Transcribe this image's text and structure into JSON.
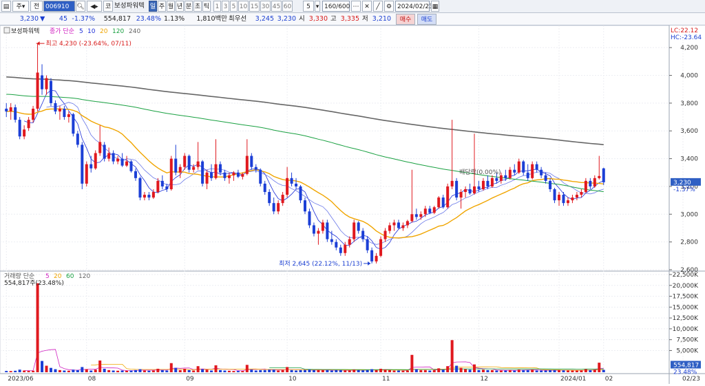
{
  "toolbar": {
    "period_select": "주",
    "code_type": "전",
    "stock_code": "006910",
    "stock_prefix": "코",
    "stock_name": "보성파워텍",
    "tabs": [
      "일",
      "주",
      "월",
      "년",
      "분",
      "초",
      "틱"
    ],
    "active_tab": "일",
    "minute_options": [
      "1",
      "3",
      "5",
      "10",
      "15",
      "30",
      "45",
      "60"
    ],
    "interval_value": "5",
    "count_display": "160/600",
    "date_value": "2024/02/23"
  },
  "quote": {
    "price": "3,230",
    "direction_arrow": "▼",
    "change": "45",
    "change_rate": "-1.37%",
    "volume": "554,817",
    "volume_rate": "23.48%",
    "turnover_rate": "1.13%",
    "amount": "1,810백만",
    "prefer_label": "최우선",
    "ask": "3,245",
    "bid": "3,230",
    "open_label": "시",
    "open": "3,330",
    "high_label": "고",
    "high": "3,335",
    "low_label": "저",
    "low": "3,210",
    "buy_button": "매수",
    "sell_button": "매도"
  },
  "price_panel": {
    "name_label": "보성파워텍",
    "legend_prefix": "종가 단순",
    "ma_periods": [
      {
        "label": "5",
        "color": "#1e2fd8"
      },
      {
        "label": "10",
        "color": "#1e2fd8"
      },
      {
        "label": "20",
        "color": "#f0a500"
      },
      {
        "label": "120",
        "color": "#18a040"
      },
      {
        "label": "240",
        "color": "#666666"
      }
    ],
    "lc_label": "LC:22.12",
    "hc_label": "HC:-23.64",
    "y_ticks": [
      "4,200",
      "4,000",
      "3,800",
      "3,600",
      "3,400",
      "3,200",
      "3,000",
      "2,800",
      "2,600"
    ],
    "current_price_label": "3,230",
    "current_rate_label": "-1.37%",
    "high_annotation": "최고 4,230 (-23.64%, 07/11)",
    "low_annotation": "최저 2,645 (22.12%, 11/13)",
    "dividend_annotation": "배당락(0.00%)"
  },
  "volume_panel": {
    "legend_prefix": "거래량 단순",
    "ma_periods": [
      {
        "label": "5",
        "color": "#d020c0"
      },
      {
        "label": "20",
        "color": "#f0a500"
      },
      {
        "label": "60",
        "color": "#18a040"
      },
      {
        "label": "120",
        "color": "#666666"
      }
    ],
    "current_value_label": "554,817주(23.48%)",
    "y_ticks": [
      "22,500K",
      "20,000K",
      "17,500K",
      "15,000K",
      "12,500K",
      "10,000K",
      "7,500K",
      "5,000K"
    ],
    "current_volume_label": "554,817",
    "current_volume_rate": "23.48%"
  },
  "x_axis": {
    "labels": [
      "2023/06",
      "08",
      "09",
      "10",
      "11",
      "12",
      "2024/01",
      "02",
      "02/23"
    ]
  },
  "chart_data": {
    "type": "candlestick",
    "price_axis": {
      "min": 2600,
      "max": 4300
    },
    "volume_axis": {
      "min": 0,
      "max": 22500,
      "unit": "K"
    },
    "candles": [
      {
        "o": 3760,
        "h": 3800,
        "l": 3700,
        "c": 3740,
        "v": 300
      },
      {
        "o": 3740,
        "h": 3800,
        "l": 3680,
        "c": 3770,
        "v": 280
      },
      {
        "o": 3770,
        "h": 3790,
        "l": 3660,
        "c": 3680,
        "v": 350
      },
      {
        "o": 3680,
        "h": 3700,
        "l": 3540,
        "c": 3560,
        "v": 600
      },
      {
        "o": 3560,
        "h": 3640,
        "l": 3540,
        "c": 3610,
        "v": 400
      },
      {
        "o": 3620,
        "h": 3700,
        "l": 3600,
        "c": 3680,
        "v": 300
      },
      {
        "o": 3680,
        "h": 3780,
        "l": 3660,
        "c": 3760,
        "v": 350
      },
      {
        "o": 3760,
        "h": 4230,
        "l": 3740,
        "c": 4020,
        "v": 20500
      },
      {
        "o": 4000,
        "h": 4080,
        "l": 3860,
        "c": 3900,
        "v": 2600
      },
      {
        "o": 3900,
        "h": 4000,
        "l": 3860,
        "c": 3980,
        "v": 1500
      },
      {
        "o": 3960,
        "h": 3980,
        "l": 3780,
        "c": 3800,
        "v": 1000
      },
      {
        "o": 3800,
        "h": 3820,
        "l": 3720,
        "c": 3740,
        "v": 700
      },
      {
        "o": 3740,
        "h": 3780,
        "l": 3680,
        "c": 3760,
        "v": 500
      },
      {
        "o": 3760,
        "h": 3780,
        "l": 3680,
        "c": 3700,
        "v": 400
      },
      {
        "o": 3700,
        "h": 3740,
        "l": 3660,
        "c": 3720,
        "v": 350
      },
      {
        "o": 3720,
        "h": 3730,
        "l": 3560,
        "c": 3580,
        "v": 600
      },
      {
        "o": 3580,
        "h": 3600,
        "l": 3480,
        "c": 3500,
        "v": 500
      },
      {
        "o": 3500,
        "h": 3520,
        "l": 3180,
        "c": 3220,
        "v": 1200
      },
      {
        "o": 3220,
        "h": 3380,
        "l": 3200,
        "c": 3360,
        "v": 700
      },
      {
        "o": 3360,
        "h": 3420,
        "l": 3300,
        "c": 3330,
        "v": 400
      },
      {
        "o": 3330,
        "h": 3460,
        "l": 3320,
        "c": 3440,
        "v": 600
      },
      {
        "o": 3440,
        "h": 3640,
        "l": 3420,
        "c": 3520,
        "v": 2700
      },
      {
        "o": 3500,
        "h": 3520,
        "l": 3380,
        "c": 3400,
        "v": 800
      },
      {
        "o": 3400,
        "h": 3480,
        "l": 3380,
        "c": 3440,
        "v": 500
      },
      {
        "o": 3440,
        "h": 3460,
        "l": 3360,
        "c": 3380,
        "v": 400
      },
      {
        "o": 3380,
        "h": 3420,
        "l": 3360,
        "c": 3400,
        "v": 350
      },
      {
        "o": 3400,
        "h": 3440,
        "l": 3340,
        "c": 3350,
        "v": 400
      },
      {
        "o": 3350,
        "h": 3420,
        "l": 3340,
        "c": 3380,
        "v": 350
      },
      {
        "o": 3380,
        "h": 3390,
        "l": 3300,
        "c": 3310,
        "v": 400
      },
      {
        "o": 3310,
        "h": 3330,
        "l": 3240,
        "c": 3260,
        "v": 500
      },
      {
        "o": 3260,
        "h": 3270,
        "l": 3100,
        "c": 3120,
        "v": 700
      },
      {
        "o": 3120,
        "h": 3160,
        "l": 3100,
        "c": 3140,
        "v": 400
      },
      {
        "o": 3140,
        "h": 3160,
        "l": 3100,
        "c": 3120,
        "v": 350
      },
      {
        "o": 3120,
        "h": 3180,
        "l": 3110,
        "c": 3160,
        "v": 400
      },
      {
        "o": 3160,
        "h": 3260,
        "l": 3150,
        "c": 3240,
        "v": 800
      },
      {
        "o": 3240,
        "h": 3280,
        "l": 3180,
        "c": 3200,
        "v": 500
      },
      {
        "o": 3200,
        "h": 3220,
        "l": 3160,
        "c": 3180,
        "v": 400
      },
      {
        "o": 3180,
        "h": 3420,
        "l": 3170,
        "c": 3400,
        "v": 2100
      },
      {
        "o": 3400,
        "h": 3500,
        "l": 3280,
        "c": 3300,
        "v": 1000
      },
      {
        "o": 3300,
        "h": 3360,
        "l": 3260,
        "c": 3340,
        "v": 500
      },
      {
        "o": 3340,
        "h": 3440,
        "l": 3320,
        "c": 3420,
        "v": 800
      },
      {
        "o": 3420,
        "h": 3430,
        "l": 3300,
        "c": 3320,
        "v": 500
      },
      {
        "o": 3320,
        "h": 3360,
        "l": 3300,
        "c": 3340,
        "v": 400
      },
      {
        "o": 3340,
        "h": 3520,
        "l": 3320,
        "c": 3380,
        "v": 1400
      },
      {
        "o": 3380,
        "h": 3390,
        "l": 3200,
        "c": 3220,
        "v": 700
      },
      {
        "o": 3220,
        "h": 3320,
        "l": 3180,
        "c": 3300,
        "v": 600
      },
      {
        "o": 3300,
        "h": 3360,
        "l": 3240,
        "c": 3260,
        "v": 400
      },
      {
        "o": 3260,
        "h": 3540,
        "l": 3250,
        "c": 3360,
        "v": 1600
      },
      {
        "o": 3360,
        "h": 3380,
        "l": 3280,
        "c": 3300,
        "v": 500
      },
      {
        "o": 3300,
        "h": 3320,
        "l": 3240,
        "c": 3260,
        "v": 400
      },
      {
        "o": 3260,
        "h": 3300,
        "l": 3220,
        "c": 3280,
        "v": 350
      },
      {
        "o": 3280,
        "h": 3310,
        "l": 3240,
        "c": 3300,
        "v": 300
      },
      {
        "o": 3300,
        "h": 3320,
        "l": 3260,
        "c": 3270,
        "v": 300
      },
      {
        "o": 3270,
        "h": 3300,
        "l": 3250,
        "c": 3290,
        "v": 300
      },
      {
        "o": 3290,
        "h": 3540,
        "l": 3280,
        "c": 3420,
        "v": 1700
      },
      {
        "o": 3420,
        "h": 3440,
        "l": 3320,
        "c": 3340,
        "v": 600
      },
      {
        "o": 3340,
        "h": 3360,
        "l": 3300,
        "c": 3320,
        "v": 400
      },
      {
        "o": 3320,
        "h": 3330,
        "l": 3200,
        "c": 3220,
        "v": 500
      },
      {
        "o": 3220,
        "h": 3240,
        "l": 3140,
        "c": 3160,
        "v": 500
      },
      {
        "o": 3160,
        "h": 3180,
        "l": 3060,
        "c": 3080,
        "v": 600
      },
      {
        "o": 3080,
        "h": 3120,
        "l": 3000,
        "c": 3020,
        "v": 600
      },
      {
        "o": 3020,
        "h": 3100,
        "l": 3000,
        "c": 3080,
        "v": 400
      },
      {
        "o": 3080,
        "h": 3160,
        "l": 3060,
        "c": 3140,
        "v": 500
      },
      {
        "o": 3140,
        "h": 3340,
        "l": 3120,
        "c": 3260,
        "v": 1200
      },
      {
        "o": 3260,
        "h": 3300,
        "l": 3200,
        "c": 3220,
        "v": 500
      },
      {
        "o": 3220,
        "h": 3260,
        "l": 3180,
        "c": 3200,
        "v": 400
      },
      {
        "o": 3200,
        "h": 3210,
        "l": 3080,
        "c": 3100,
        "v": 500
      },
      {
        "o": 3100,
        "h": 3120,
        "l": 3000,
        "c": 3020,
        "v": 500
      },
      {
        "o": 3020,
        "h": 3040,
        "l": 2900,
        "c": 2920,
        "v": 600
      },
      {
        "o": 2920,
        "h": 2940,
        "l": 2840,
        "c": 2860,
        "v": 500
      },
      {
        "o": 2860,
        "h": 2900,
        "l": 2780,
        "c": 2880,
        "v": 500
      },
      {
        "o": 2880,
        "h": 2960,
        "l": 2860,
        "c": 2940,
        "v": 500
      },
      {
        "o": 2940,
        "h": 2960,
        "l": 2800,
        "c": 2820,
        "v": 500
      },
      {
        "o": 2820,
        "h": 2880,
        "l": 2780,
        "c": 2800,
        "v": 400
      },
      {
        "o": 2800,
        "h": 2820,
        "l": 2740,
        "c": 2760,
        "v": 500
      },
      {
        "o": 2760,
        "h": 2780,
        "l": 2700,
        "c": 2720,
        "v": 500
      },
      {
        "o": 2720,
        "h": 2800,
        "l": 2700,
        "c": 2780,
        "v": 400
      },
      {
        "o": 2780,
        "h": 2840,
        "l": 2760,
        "c": 2820,
        "v": 400
      },
      {
        "o": 2820,
        "h": 2960,
        "l": 2800,
        "c": 2940,
        "v": 600
      },
      {
        "o": 2940,
        "h": 2950,
        "l": 2860,
        "c": 2880,
        "v": 500
      },
      {
        "o": 2880,
        "h": 2900,
        "l": 2800,
        "c": 2820,
        "v": 450
      },
      {
        "o": 2820,
        "h": 2840,
        "l": 2720,
        "c": 2740,
        "v": 500
      },
      {
        "o": 2740,
        "h": 2760,
        "l": 2645,
        "c": 2660,
        "v": 700
      },
      {
        "o": 2660,
        "h": 2720,
        "l": 2645,
        "c": 2700,
        "v": 500
      },
      {
        "o": 2700,
        "h": 2840,
        "l": 2690,
        "c": 2820,
        "v": 800
      },
      {
        "o": 2820,
        "h": 2900,
        "l": 2800,
        "c": 2880,
        "v": 600
      },
      {
        "o": 2880,
        "h": 2940,
        "l": 2860,
        "c": 2920,
        "v": 500
      },
      {
        "o": 2920,
        "h": 2960,
        "l": 2880,
        "c": 2940,
        "v": 400
      },
      {
        "o": 2940,
        "h": 2960,
        "l": 2890,
        "c": 2900,
        "v": 400
      },
      {
        "o": 2900,
        "h": 2940,
        "l": 2880,
        "c": 2920,
        "v": 350
      },
      {
        "o": 2920,
        "h": 2960,
        "l": 2900,
        "c": 2950,
        "v": 400
      },
      {
        "o": 2950,
        "h": 3320,
        "l": 2940,
        "c": 3000,
        "v": 4000
      },
      {
        "o": 3000,
        "h": 3040,
        "l": 2960,
        "c": 2980,
        "v": 700
      },
      {
        "o": 2980,
        "h": 3020,
        "l": 2960,
        "c": 3000,
        "v": 500
      },
      {
        "o": 3000,
        "h": 3060,
        "l": 2980,
        "c": 3040,
        "v": 500
      },
      {
        "o": 3040,
        "h": 3060,
        "l": 3000,
        "c": 3010,
        "v": 400
      },
      {
        "o": 3010,
        "h": 3060,
        "l": 3000,
        "c": 3050,
        "v": 500
      },
      {
        "o": 3050,
        "h": 3130,
        "l": 3040,
        "c": 3120,
        "v": 900
      },
      {
        "o": 3120,
        "h": 3140,
        "l": 3040,
        "c": 3050,
        "v": 600
      },
      {
        "o": 3050,
        "h": 3220,
        "l": 3040,
        "c": 3200,
        "v": 1400
      },
      {
        "o": 3200,
        "h": 3680,
        "l": 3180,
        "c": 3240,
        "v": 7400
      },
      {
        "o": 3240,
        "h": 3260,
        "l": 3100,
        "c": 3120,
        "v": 1500
      },
      {
        "o": 3120,
        "h": 3180,
        "l": 3040,
        "c": 3160,
        "v": 1000
      },
      {
        "o": 3160,
        "h": 3200,
        "l": 3120,
        "c": 3180,
        "v": 700
      },
      {
        "o": 3180,
        "h": 3220,
        "l": 3140,
        "c": 3150,
        "v": 600
      },
      {
        "o": 3150,
        "h": 3580,
        "l": 3140,
        "c": 3200,
        "v": 1800
      },
      {
        "o": 3200,
        "h": 3240,
        "l": 3160,
        "c": 3180,
        "v": 500
      },
      {
        "o": 3180,
        "h": 3260,
        "l": 3170,
        "c": 3240,
        "v": 600
      },
      {
        "o": 3240,
        "h": 3280,
        "l": 3180,
        "c": 3200,
        "v": 500
      },
      {
        "o": 3200,
        "h": 3280,
        "l": 3190,
        "c": 3260,
        "v": 500
      },
      {
        "o": 3260,
        "h": 3300,
        "l": 3220,
        "c": 3240,
        "v": 400
      },
      {
        "o": 3240,
        "h": 3300,
        "l": 3220,
        "c": 3280,
        "v": 400
      },
      {
        "o": 3280,
        "h": 3320,
        "l": 3240,
        "c": 3260,
        "v": 400
      },
      {
        "o": 3260,
        "h": 3340,
        "l": 3250,
        "c": 3320,
        "v": 500
      },
      {
        "o": 3320,
        "h": 3360,
        "l": 3280,
        "c": 3300,
        "v": 400
      },
      {
        "o": 3300,
        "h": 3400,
        "l": 3290,
        "c": 3380,
        "v": 600
      },
      {
        "o": 3380,
        "h": 3390,
        "l": 3280,
        "c": 3300,
        "v": 500
      },
      {
        "o": 3300,
        "h": 3360,
        "l": 3240,
        "c": 3260,
        "v": 500
      },
      {
        "o": 3260,
        "h": 3380,
        "l": 3250,
        "c": 3360,
        "v": 600
      },
      {
        "o": 3360,
        "h": 3380,
        "l": 3300,
        "c": 3320,
        "v": 400
      },
      {
        "o": 3320,
        "h": 3340,
        "l": 3260,
        "c": 3280,
        "v": 400
      },
      {
        "o": 3280,
        "h": 3300,
        "l": 3220,
        "c": 3240,
        "v": 400
      },
      {
        "o": 3240,
        "h": 3260,
        "l": 3160,
        "c": 3180,
        "v": 500
      },
      {
        "o": 3180,
        "h": 3190,
        "l": 3080,
        "c": 3100,
        "v": 500
      },
      {
        "o": 3100,
        "h": 3160,
        "l": 3060,
        "c": 3140,
        "v": 500
      },
      {
        "o": 3140,
        "h": 3160,
        "l": 3060,
        "c": 3080,
        "v": 450
      },
      {
        "o": 3080,
        "h": 3120,
        "l": 3060,
        "c": 3100,
        "v": 400
      },
      {
        "o": 3100,
        "h": 3140,
        "l": 3080,
        "c": 3120,
        "v": 400
      },
      {
        "o": 3120,
        "h": 3160,
        "l": 3100,
        "c": 3140,
        "v": 400
      },
      {
        "o": 3140,
        "h": 3180,
        "l": 3120,
        "c": 3160,
        "v": 450
      },
      {
        "o": 3160,
        "h": 3260,
        "l": 3150,
        "c": 3240,
        "v": 700
      },
      {
        "o": 3240,
        "h": 3260,
        "l": 3180,
        "c": 3200,
        "v": 500
      },
      {
        "o": 3200,
        "h": 3280,
        "l": 3190,
        "c": 3260,
        "v": 600
      },
      {
        "o": 3260,
        "h": 3420,
        "l": 3250,
        "c": 3275,
        "v": 2200
      },
      {
        "o": 3330,
        "h": 3335,
        "l": 3210,
        "c": 3230,
        "v": 554.8
      }
    ],
    "events": {
      "high_index": 7,
      "low_index": 82,
      "dividend_index": 101
    }
  }
}
